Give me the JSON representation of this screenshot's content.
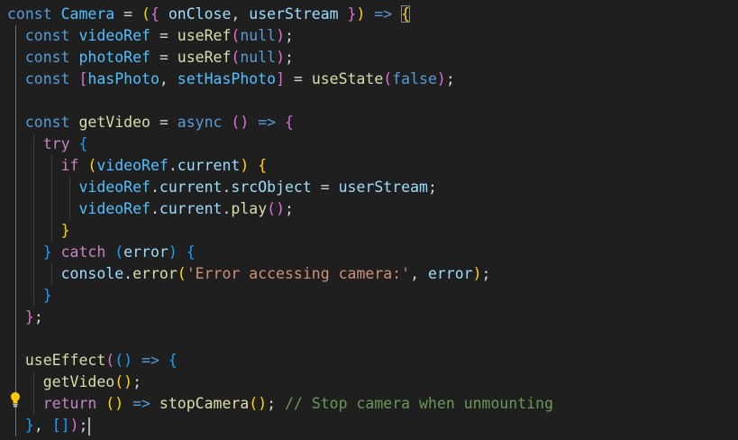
{
  "editor": {
    "language": "javascript",
    "lightbulb_icon": "lightbulb-icon",
    "lines": [
      "const Camera = ({ onClose, userStream }) => {",
      "  const videoRef = useRef(null);",
      "  const photoRef = useRef(null);",
      "  const [hasPhoto, setHasPhoto] = useState(false);",
      "",
      "  const getVideo = async () => {",
      "    try {",
      "      if (videoRef.current) {",
      "        videoRef.current.srcObject = userStream;",
      "        videoRef.current.play();",
      "      }",
      "    } catch (error) {",
      "      console.error('Error accessing camera:', error);",
      "    }",
      "  };",
      "",
      "  useEffect(() => {",
      "    getVideo();",
      "    return () => stopCamera(); // Stop camera when unmounting",
      "  }, []);"
    ]
  },
  "tokens": {
    "const": "const",
    "camera": "Camera",
    "on_close": "onClose",
    "user_stream": "userStream",
    "arrow": "=>",
    "video_ref": "videoRef",
    "photo_ref": "photoRef",
    "use_ref": "useRef",
    "null": "null",
    "has_photo": "hasPhoto",
    "set_has_photo": "setHasPhoto",
    "use_state": "useState",
    "false": "false",
    "get_video": "getVideo",
    "async": "async",
    "try": "try",
    "if": "if",
    "current": "current",
    "src_object": "srcObject",
    "play": "play",
    "catch": "catch",
    "error": "error",
    "console": "console",
    "error_fn": "error",
    "error_message": "'Error accessing camera:'",
    "use_effect": "useEffect",
    "return": "return",
    "stop_camera": "stopCamera",
    "comment": "// Stop camera when unmounting"
  },
  "theme": {
    "background": "#1f1f1f",
    "keyword": "#569cd6",
    "control": "#c586c0",
    "variable": "#9cdcfe",
    "constant": "#4fc1ff",
    "function": "#dcdcaa",
    "string": "#ce9178",
    "comment": "#6a9955",
    "bracket_level_1": "#ffd700",
    "bracket_level_2": "#da70d6",
    "bracket_level_3": "#179fff"
  }
}
